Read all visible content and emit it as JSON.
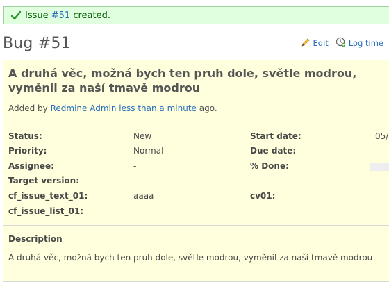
{
  "flash": {
    "prefix": "Issue ",
    "issue_link": "#51",
    "suffix": " created."
  },
  "header": {
    "title": "Bug #51",
    "edit_label": "Edit",
    "logtime_label": "Log time"
  },
  "issue": {
    "subject": "A druhá věc, možná bych ten pruh dole, světle modrou, vyměnil za naší tmavě modrou",
    "added_by_prefix": "Added by ",
    "author": "Redmine Admin",
    "time": "less than a minute",
    "added_by_suffix": " ago.",
    "attributes_left": [
      {
        "label": "Status:",
        "value": "New"
      },
      {
        "label": "Priority:",
        "value": "Normal"
      },
      {
        "label": "Assignee:",
        "value": "-"
      },
      {
        "label": "Target version:",
        "value": "-"
      },
      {
        "label": "cf_issue_text_01:",
        "value": "aaaa"
      },
      {
        "label": "cf_issue_list_01:",
        "value": ""
      }
    ],
    "attributes_right": [
      {
        "label": "Start date:",
        "value": "05/"
      },
      {
        "label": "Due date:",
        "value": ""
      },
      {
        "label": "% Done:",
        "value": ""
      },
      {
        "label": "",
        "value": ""
      },
      {
        "label": "cv01:",
        "value": ""
      }
    ],
    "done_fraction": 0,
    "description_heading": "Description",
    "description_text": "A druhá věc, možná bych ten pruh dole, světle modrou, vyměnil za naší tmavě modrou"
  },
  "colors": {
    "flash_bg": "#dfffdf",
    "issue_bg": "#ffffdd",
    "link": "#2a6ebb"
  },
  "icons": {
    "flash": "check-icon",
    "edit": "pencil-icon",
    "logtime": "clock-icon"
  }
}
